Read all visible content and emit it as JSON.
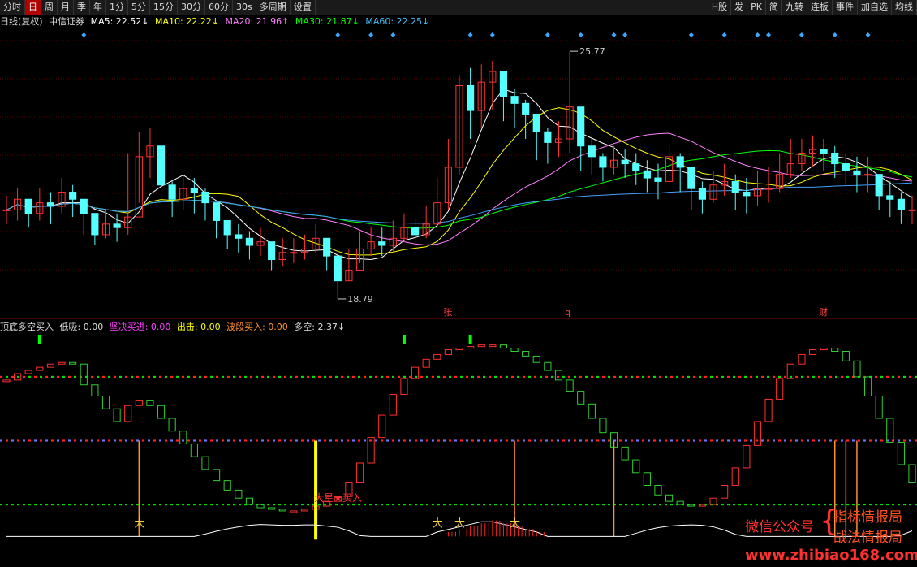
{
  "toolbar": {
    "left": [
      "分时",
      "日",
      "周",
      "月",
      "季",
      "年",
      "1分",
      "5分",
      "15分",
      "30分",
      "60分",
      "30s",
      "多周期",
      "设置"
    ],
    "active": "日",
    "right": [
      "H股",
      "发",
      "PK",
      "简",
      "九转",
      "连板",
      "事件",
      "加自选",
      "均线"
    ]
  },
  "legend_top": {
    "period": "日线(复权)",
    "stock": "中信证券",
    "ma5": "MA5: 22.52↓",
    "ma10": "MA10: 22.22↓",
    "ma20": "MA20: 21.96↑",
    "ma30": "MA30: 21.87↓",
    "ma60": "MA60: 22.25↓",
    "colors": {
      "ma5": "#ffffff",
      "ma10": "#ffff00",
      "ma20": "#ff80ff",
      "ma30": "#00ff00",
      "ma60": "#40a0ff"
    }
  },
  "legend_bottom": {
    "name": "顶底多空买入",
    "dx": "低吸: 0.00",
    "jj": "坚决买进: 0.00",
    "cj": "出击: 0.00",
    "bd": "波段买入: 0.00",
    "dk": "多空: 2.37↓"
  },
  "chart_data": [
    {
      "type": "candlestick",
      "stock": "中信证券",
      "period": "日线(复权)",
      "annotations": {
        "max_label": "25.77",
        "min_label": "18.79",
        "markers": [
          "张",
          "q",
          "财"
        ]
      },
      "ma_values": {
        "MA5": 22.52,
        "MA10": 22.22,
        "MA20": 21.96,
        "MA30": 21.87,
        "MA60": 22.25
      },
      "close": [
        21.3,
        21.6,
        21.2,
        21.5,
        21.4,
        21.8,
        21.6,
        21.2,
        20.6,
        20.9,
        20.8,
        21.1,
        22.8,
        23.1,
        22.0,
        21.6,
        21.9,
        21.8,
        21.5,
        21.0,
        20.6,
        20.5,
        20.3,
        20.4,
        19.9,
        20.1,
        20.1,
        20.2,
        20.5,
        20.0,
        19.3,
        19.6,
        20.2,
        20.4,
        20.3,
        20.5,
        20.8,
        20.6,
        20.9,
        21.5,
        22.5,
        24.8,
        24.1,
        24.9,
        25.2,
        24.5,
        24.3,
        24.0,
        23.5,
        23.2,
        23.3,
        24.2,
        23.1,
        22.8,
        22.5,
        22.7,
        22.6,
        22.4,
        22.2,
        22.1,
        22.8,
        22.5,
        21.9,
        21.6,
        22.0,
        22.1,
        21.8,
        21.7,
        21.9,
        21.9,
        22.3,
        22.6,
        22.9,
        23.0,
        22.9,
        22.6,
        22.4,
        22.3,
        22.3,
        21.7,
        21.6,
        21.3,
        21.3
      ],
      "low": [
        20.9,
        21.0,
        20.8,
        21.0,
        20.9,
        21.2,
        21.1,
        20.6,
        20.3,
        20.5,
        20.4,
        20.6,
        21.5,
        22.2,
        21.5,
        21.1,
        21.3,
        21.2,
        21.0,
        20.5,
        20.2,
        20.1,
        19.9,
        20.0,
        19.6,
        19.7,
        19.8,
        19.9,
        20.1,
        19.6,
        18.79,
        19.3,
        19.8,
        20.0,
        20.0,
        20.1,
        20.4,
        20.3,
        20.5,
        20.8,
        21.3,
        22.3,
        23.3,
        23.6,
        24.1,
        23.8,
        23.6,
        23.3,
        22.7,
        22.6,
        22.8,
        22.9,
        22.4,
        22.3,
        22.1,
        22.3,
        22.2,
        22.0,
        21.8,
        21.6,
        22.0,
        21.8,
        21.3,
        21.2,
        21.5,
        21.7,
        21.3,
        21.2,
        21.4,
        21.5,
        21.8,
        22.2,
        22.4,
        22.5,
        22.4,
        22.2,
        22.0,
        21.8,
        21.8,
        21.3,
        21.1,
        20.9,
        20.9
      ],
      "high": [
        21.7,
        21.9,
        21.6,
        21.9,
        21.8,
        22.2,
        22.0,
        21.6,
        21.0,
        21.3,
        21.2,
        22.9,
        23.5,
        23.6,
        22.8,
        22.1,
        22.3,
        22.2,
        21.9,
        21.4,
        21.0,
        20.9,
        20.7,
        20.8,
        20.3,
        20.5,
        20.5,
        20.6,
        20.9,
        20.4,
        19.8,
        20.2,
        20.7,
        20.8,
        20.8,
        21.0,
        21.2,
        21.1,
        21.4,
        22.2,
        23.3,
        25.1,
        25.3,
        25.4,
        25.5,
        25.0,
        24.7,
        24.4,
        24.0,
        23.6,
        23.8,
        25.77,
        23.8,
        23.3,
        22.9,
        23.1,
        23.0,
        22.9,
        22.7,
        22.6,
        23.2,
        22.9,
        22.4,
        22.1,
        22.4,
        22.6,
        22.3,
        22.2,
        22.4,
        22.5,
        22.9,
        23.3,
        23.3,
        23.4,
        23.3,
        23.1,
        22.9,
        22.8,
        22.8,
        22.3,
        22.1,
        21.8,
        21.7
      ]
    },
    {
      "type": "line",
      "name": "顶底多空买入",
      "levels": [
        90,
        50,
        10
      ],
      "oscillator": [
        88,
        92,
        94,
        96,
        98,
        99,
        98,
        85,
        78,
        70,
        62,
        72,
        75,
        72,
        64,
        56,
        48,
        40,
        32,
        25,
        19,
        14,
        10,
        8,
        7,
        6,
        6,
        7,
        9,
        12,
        15,
        24,
        36,
        52,
        66,
        79,
        89,
        96,
        101,
        104,
        107,
        108,
        109,
        110,
        110,
        108,
        106,
        103,
        99,
        94,
        88,
        81,
        73,
        64,
        55,
        46,
        38,
        30,
        22,
        16,
        12,
        10,
        9,
        10,
        14,
        22,
        33,
        47,
        62,
        76,
        89,
        98,
        104,
        107,
        108,
        106,
        100,
        90,
        78,
        64,
        49,
        35,
        24
      ]
    }
  ],
  "watermark": {
    "wechat": "微信公众号",
    "line1": "指标情报局",
    "line2": "战法情报局",
    "site": "www.zhibiao168.com"
  },
  "star_label": "大星★买入"
}
